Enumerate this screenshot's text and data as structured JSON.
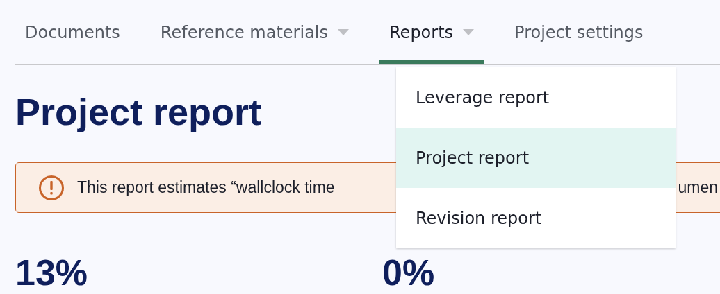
{
  "tabs": [
    {
      "label": "Documents",
      "kind": "plain",
      "selected": false
    },
    {
      "label": "Reference materials",
      "kind": "dropdown",
      "selected": false
    },
    {
      "label": "Reports",
      "kind": "dropdown",
      "selected": true
    },
    {
      "label": "Project settings",
      "kind": "plain",
      "selected": false
    }
  ],
  "dropdown_menu": {
    "items": [
      {
        "label": "Leverage report",
        "selected": false
      },
      {
        "label": "Project report",
        "selected": true
      },
      {
        "label": "Revision report",
        "selected": false
      }
    ]
  },
  "page_title": "Project report",
  "warning_banner": {
    "text_start": "This report estimates “wallclock time",
    "text_end": "umen"
  },
  "stats": [
    {
      "value": "13%"
    },
    {
      "value": "0%"
    }
  ]
}
